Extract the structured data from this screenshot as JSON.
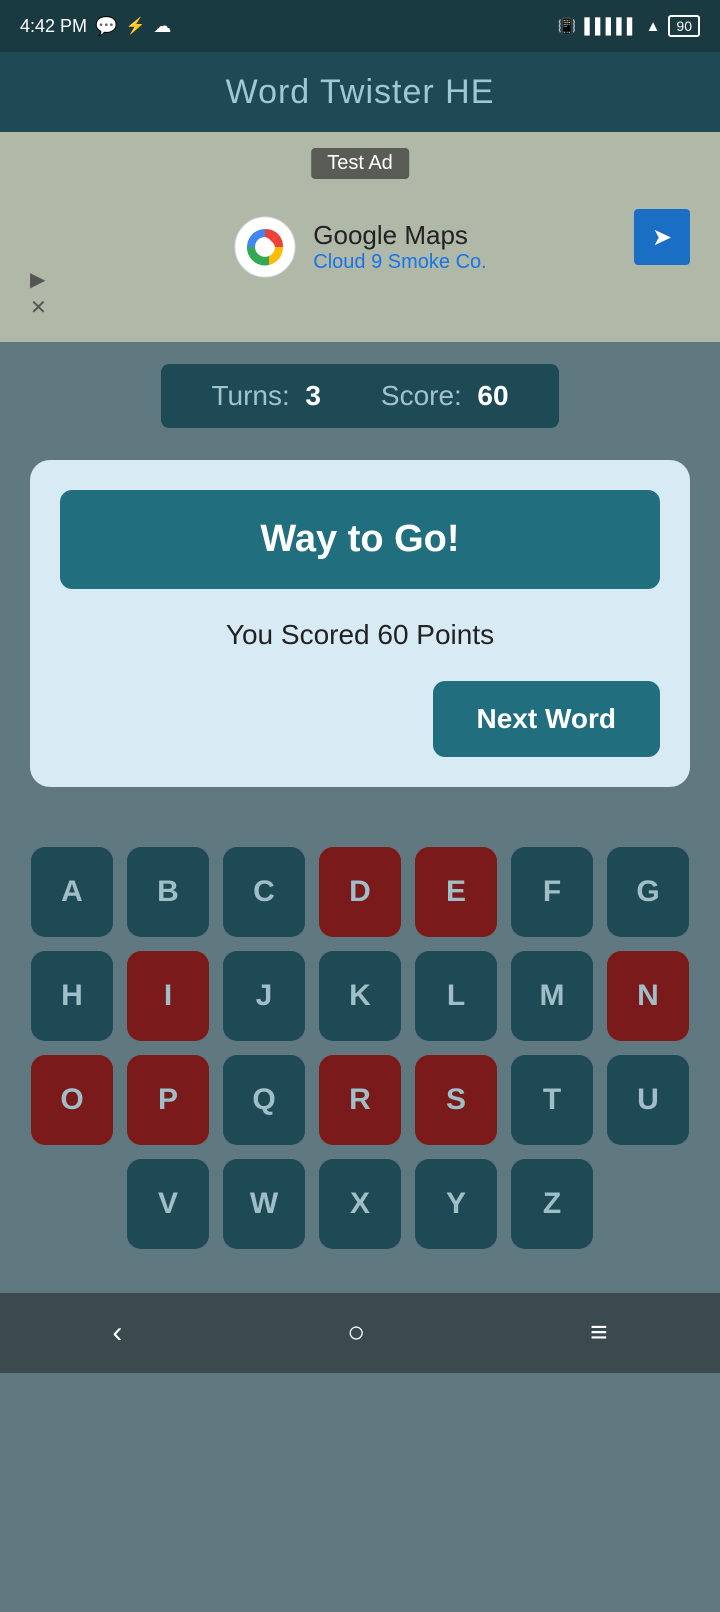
{
  "statusBar": {
    "time": "4:42 PM",
    "battery": "90"
  },
  "header": {
    "title": "Word Twister HE"
  },
  "ad": {
    "label": "Test Ad",
    "advertiser": "Google Maps",
    "location": "Cloud 9 Smoke Co."
  },
  "scoreBar": {
    "turnsLabel": "Turns:",
    "turns": "3",
    "scoreLabel": "Score:",
    "score": "60"
  },
  "modal": {
    "heading": "Way to Go!",
    "scoreText": "You Scored 60 Points",
    "nextWordLabel": "Next Word"
  },
  "keyboard": {
    "rows": [
      [
        "A",
        "B",
        "C",
        "D",
        "E",
        "F",
        "G"
      ],
      [
        "H",
        "I",
        "J",
        "K",
        "L",
        "M",
        "N"
      ],
      [
        "O",
        "P",
        "Q",
        "R",
        "S",
        "T",
        "U"
      ],
      [
        "V",
        "W",
        "X",
        "Y",
        "Z"
      ]
    ],
    "usedKeys": [
      "D",
      "E",
      "I",
      "N",
      "O",
      "P",
      "R",
      "S"
    ]
  }
}
